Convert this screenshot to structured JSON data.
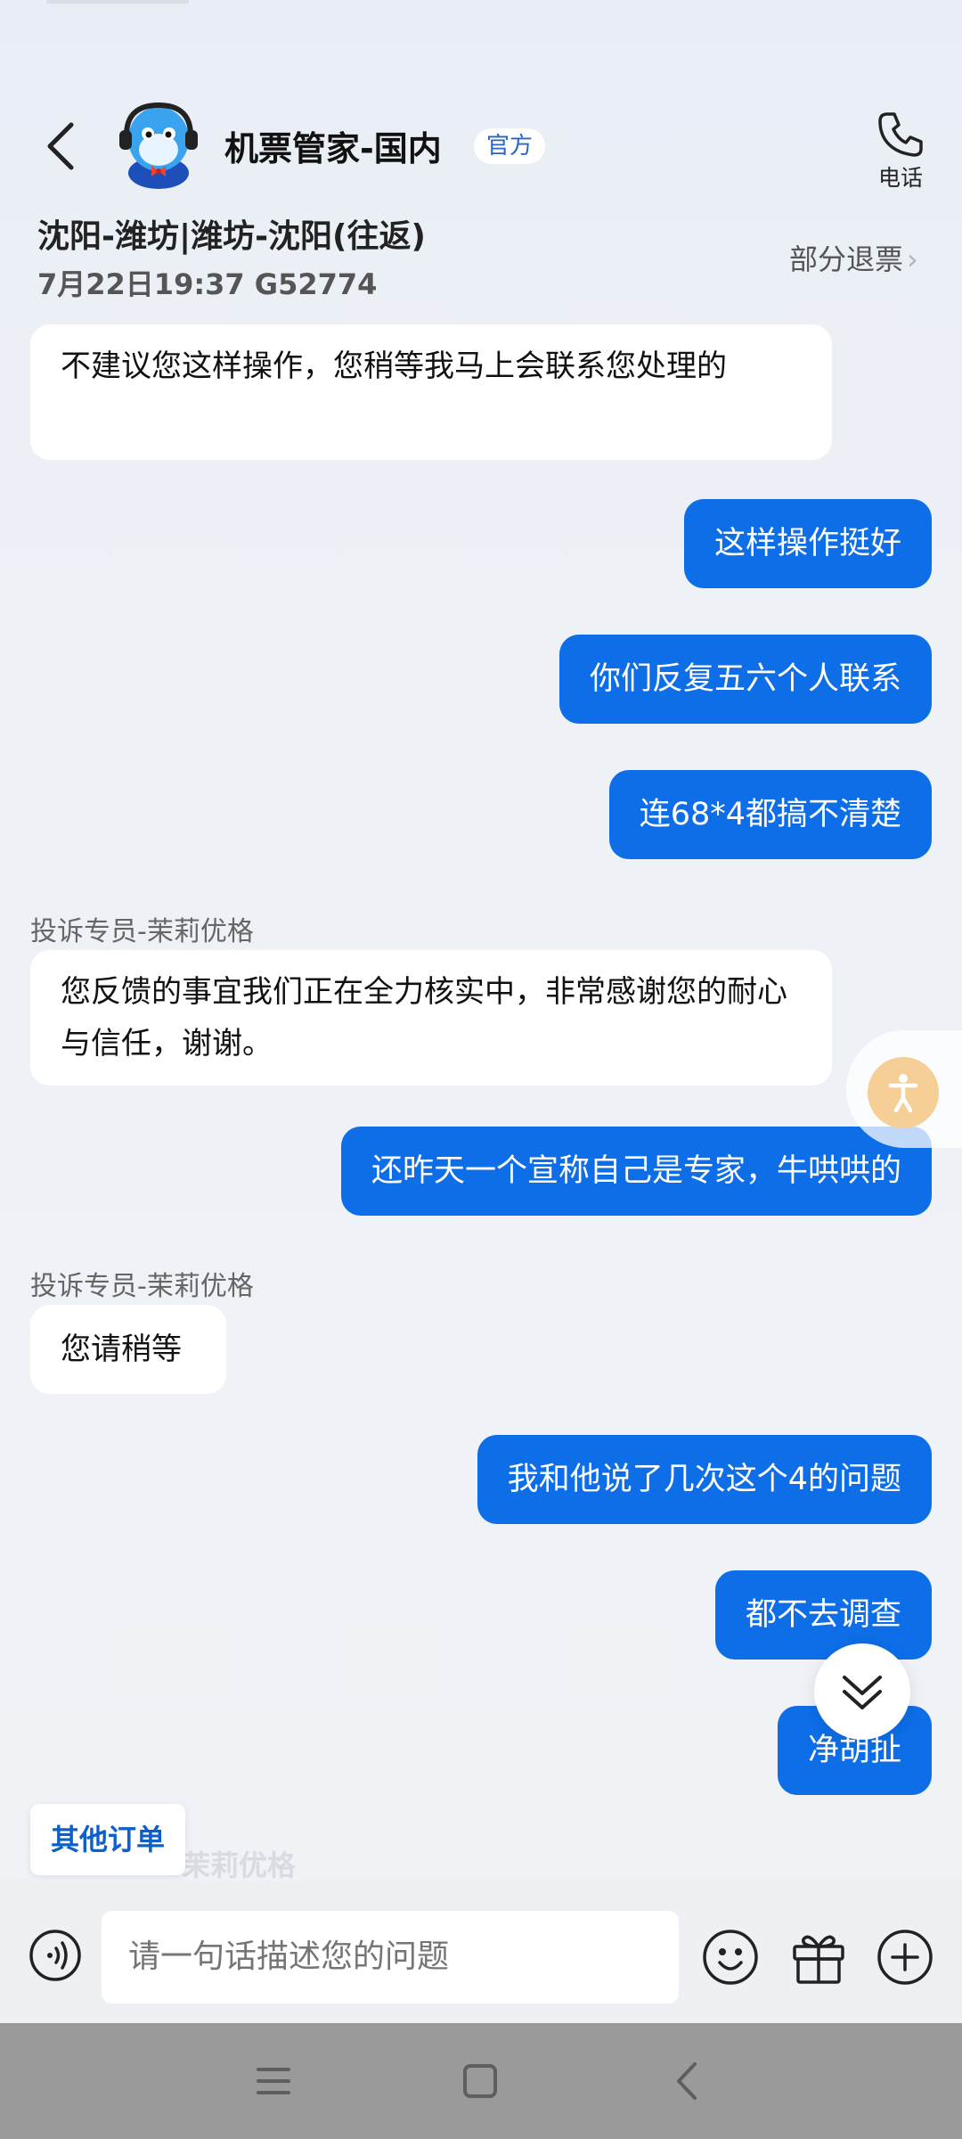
{
  "header": {
    "title": "机票管家-国内",
    "official_badge": "官方",
    "phone_label": "电话",
    "route": "沈阳-潍坊|潍坊-沈阳(往返)",
    "flight_info": "7月22日19:37 G52774",
    "refund_label": "部分退票",
    "refund_chevron": "›"
  },
  "messages": [
    {
      "side": "in",
      "text": "不建议您这样操作，您稍等我马上会联系您处理的"
    },
    {
      "side": "out",
      "text": "这样操作挺好"
    },
    {
      "side": "out",
      "text": "你们反复五六个人联系"
    },
    {
      "side": "out",
      "text": "连68*4都搞不清楚"
    },
    {
      "side": "in",
      "sender": "投诉专员-茉莉优格",
      "text": "您反馈的事宜我们正在全力核实中，非常感谢您的耐心与信任，谢谢。"
    },
    {
      "side": "out",
      "text": "还昨天一个宣称自己是专家，牛哄哄的"
    },
    {
      "side": "in",
      "sender": "投诉专员-茉莉优格",
      "text": "您请稍等"
    },
    {
      "side": "out",
      "text": "我和他说了几次这个4的问题"
    },
    {
      "side": "out",
      "text": "都不去调查"
    },
    {
      "side": "out",
      "text": "净胡扯"
    }
  ],
  "ghost_sender": "茉莉优格",
  "quick_actions": {
    "other_orders": "其他订单"
  },
  "input": {
    "placeholder": "请一句话描述您的问题"
  },
  "colors": {
    "accent": "#0d6ee8",
    "official_badge_text": "#2a64c8",
    "a11y_button": "#f5cf96"
  },
  "icons": [
    "back-arrow-icon",
    "phone-icon",
    "accessibility-icon",
    "chevron-down-icon",
    "voice-icon",
    "emoji-icon",
    "gift-icon",
    "plus-icon",
    "nav-menu-icon",
    "nav-home-icon",
    "nav-back-icon"
  ]
}
